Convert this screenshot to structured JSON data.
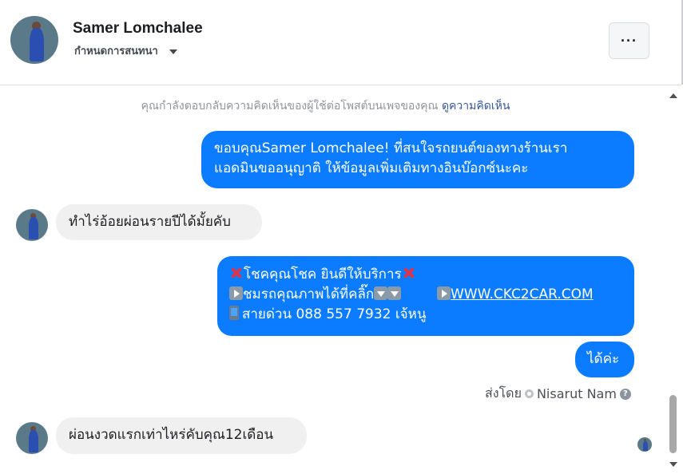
{
  "header": {
    "name": "Samer Lomchalee",
    "manage_label": "กำหนดการสนทนา",
    "more_label": "···"
  },
  "notice": {
    "text": "คุณกำลังตอบกลับความคิดเห็นของผู้ใช้ต่อโพสต์บนเพจของคุณ",
    "link": "ดูความคิดเห็น"
  },
  "messages": [
    {
      "from": "page",
      "line1": "ขอบคุณSamer Lomchalee! ที่สนใจรถยนต์ของทางร้านเรา",
      "line2": "แอดมินขออนุญาติ ให้ข้อมูลเพิ่มเติมทางอินบ๊อกซ์นะคะ"
    },
    {
      "from": "user",
      "text": "ทำไร่อ้อยผ่อนรายปีได้มั้ยคับ"
    },
    {
      "from": "page",
      "line1": "โชคคุณโชค ยินดีให้บริการ",
      "line2": "ชมรถคุณภาพได้ที่คลิ๊ก",
      "link": "WWW.CKC2CAR.COM",
      "line3": "สายด่วน 088 557 7932 เจ้หนู"
    },
    {
      "from": "page",
      "text": "ได้ค่ะ"
    },
    {
      "from": "user",
      "text": "ผ่อนงวดแรกเท่าไหร่คับคุณ12เดือน"
    }
  ],
  "sent_by": {
    "label": "ส่งโดย",
    "name": "Nisarut Nam",
    "help": "?"
  },
  "colors": {
    "outgoing": "#0b7cff",
    "incoming": "#f0f0f0",
    "link": "#385898"
  }
}
